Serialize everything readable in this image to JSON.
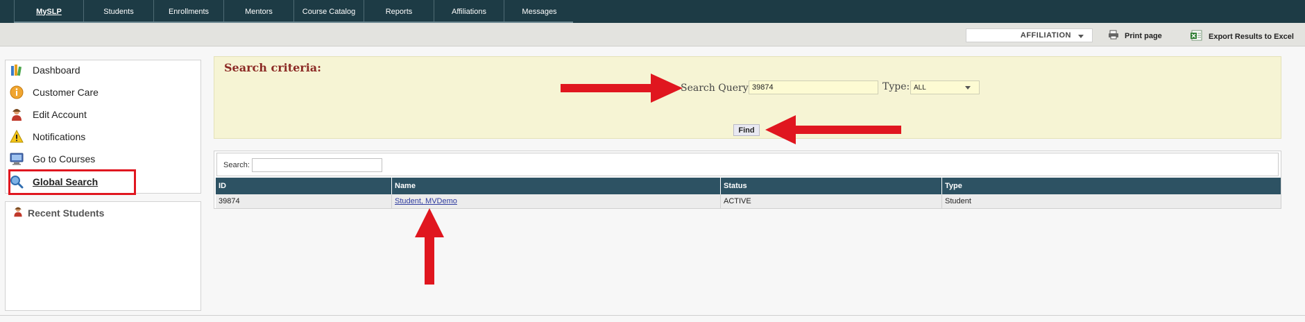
{
  "nav": {
    "tabs": [
      "MySLP",
      "Students",
      "Enrollments",
      "Mentors",
      "Course Catalog",
      "Reports",
      "Affiliations",
      "Messages"
    ]
  },
  "toolbar": {
    "affiliation_select": "AFFILIATION",
    "print_label": "Print page",
    "export_label": "Export Results to Excel"
  },
  "sidebar": {
    "items": [
      {
        "label": "Dashboard",
        "icon": "books-icon"
      },
      {
        "label": "Customer Care",
        "icon": "info-icon"
      },
      {
        "label": "Edit Account",
        "icon": "user-icon"
      },
      {
        "label": "Notifications",
        "icon": "warning-icon"
      },
      {
        "label": "Go to Courses",
        "icon": "monitor-icon"
      },
      {
        "label": "Global Search",
        "icon": "search-icon"
      }
    ],
    "active": "Global Search",
    "recent_title": "Recent Students"
  },
  "criteria": {
    "title": "Search criteria:",
    "query_label": "Search Query:",
    "query_value": "39874",
    "type_label": "Type:",
    "type_value": "ALL",
    "find_label": "Find"
  },
  "results": {
    "search_label": "Search:",
    "columns": [
      "ID",
      "Name",
      "Status",
      "Type"
    ],
    "rows": [
      {
        "id": "39874",
        "name": "Student, MVDemo",
        "status": "ACTIVE",
        "type": "Student"
      }
    ]
  },
  "colors": {
    "nav_bg": "#1d3b45",
    "table_header": "#2d5263",
    "criteria_bg": "#f6f4d4",
    "highlight_red": "#e0161f"
  }
}
